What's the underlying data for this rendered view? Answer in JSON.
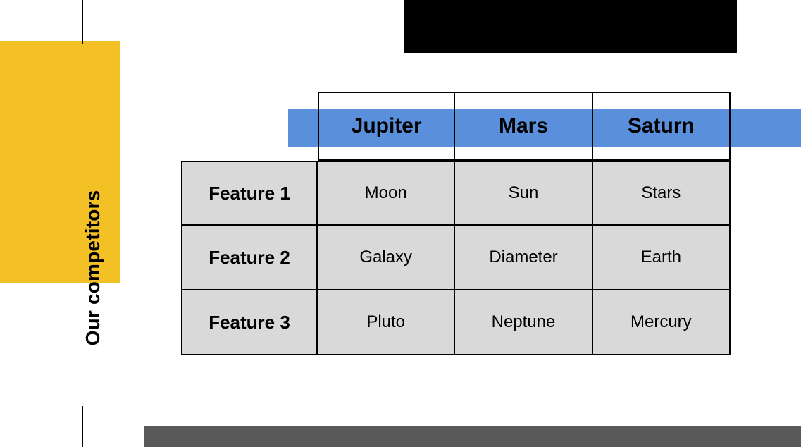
{
  "title": "Our competitors",
  "colors": {
    "accent_blue": "#5a8fdc",
    "accent_yellow": "#f3c026",
    "gray": "#595959",
    "cell_bg": "#d9d9d9",
    "black": "#000000"
  },
  "table": {
    "columns": [
      "Jupiter",
      "Mars",
      "Saturn"
    ],
    "rows": [
      {
        "feature": "Feature 1",
        "values": [
          "Moon",
          "Sun",
          "Stars"
        ]
      },
      {
        "feature": "Feature 2",
        "values": [
          "Galaxy",
          "Diameter",
          "Earth"
        ]
      },
      {
        "feature": "Feature 3",
        "values": [
          "Pluto",
          "Neptune",
          "Mercury"
        ]
      }
    ]
  },
  "chart_data": {
    "type": "table",
    "title": "Our competitors",
    "columns": [
      "",
      "Jupiter",
      "Mars",
      "Saturn"
    ],
    "rows": [
      [
        "Feature 1",
        "Moon",
        "Sun",
        "Stars"
      ],
      [
        "Feature 2",
        "Galaxy",
        "Diameter",
        "Earth"
      ],
      [
        "Feature 3",
        "Pluto",
        "Neptune",
        "Mercury"
      ]
    ]
  }
}
